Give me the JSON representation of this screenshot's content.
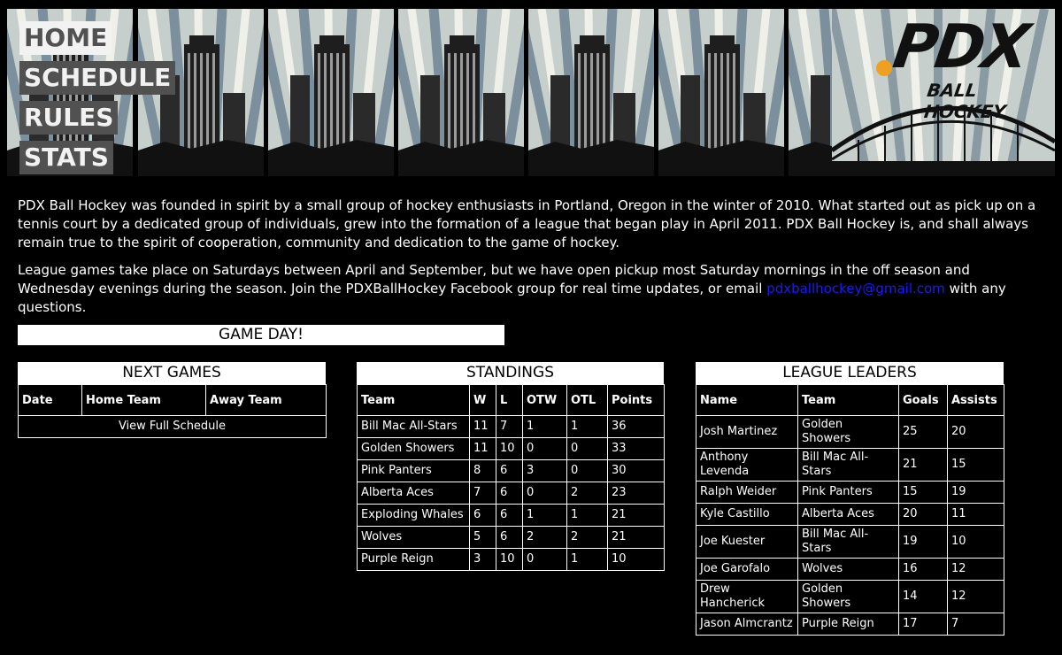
{
  "nav": {
    "home": "HOME",
    "schedule": "SCHEDULE",
    "rules": "RULES",
    "stats": "STATS"
  },
  "logo": {
    "main": "PDX",
    "sub": "BALL HOCKEY",
    "accent_color": "#f0a020"
  },
  "intro": {
    "p1": "PDX Ball Hockey was founded in spirit by a small group of hockey enthusiasts in Portland, Oregon in the winter of 2010. What started out as pick up on a tennis court by a dedicated group of individuals, grew into the formation of a league that began play in April 2011. PDX Ball Hockey is, and shall always remain true to the spirit of cooperation, community and dedication to the game of hockey.",
    "p2_before": "League games take place on Saturdays between April and September, but we have open pickup most Saturday mornings in the off season and Wednesday evenings during the season. Join the PDXBallHockey Facebook group for real time updates, or email ",
    "p2_link": "pdxballhockey@gmail.com",
    "p2_after": " with any questions."
  },
  "gameday": "GAME DAY!",
  "next_games": {
    "title": "NEXT GAMES",
    "headers": [
      "Date",
      "Home Team",
      "Away Team"
    ],
    "view_full": "View Full Schedule"
  },
  "standings": {
    "title": "STANDINGS",
    "headers": [
      "Team",
      "W",
      "L",
      "OTW",
      "OTL",
      "Points"
    ],
    "rows": [
      [
        "Bill Mac All-Stars",
        "11",
        "7",
        "1",
        "1",
        "36"
      ],
      [
        "Golden Showers",
        "11",
        "10",
        "0",
        "0",
        "33"
      ],
      [
        "Pink Panters",
        "8",
        "6",
        "3",
        "0",
        "30"
      ],
      [
        "Alberta Aces",
        "7",
        "6",
        "0",
        "2",
        "23"
      ],
      [
        "Exploding Whales",
        "6",
        "6",
        "1",
        "1",
        "21"
      ],
      [
        "Wolves",
        "5",
        "6",
        "2",
        "2",
        "21"
      ],
      [
        "Purple Reign",
        "3",
        "10",
        "0",
        "1",
        "10"
      ]
    ]
  },
  "leaders": {
    "title": "LEAGUE LEADERS",
    "headers": [
      "Name",
      "Team",
      "Goals",
      "Assists"
    ],
    "rows": [
      [
        "Josh Martinez",
        "Golden Showers",
        "25",
        "20"
      ],
      [
        "Anthony Levenda",
        "Bill Mac All-Stars",
        "21",
        "15"
      ],
      [
        "Ralph Weider",
        "Pink Panters",
        "15",
        "19"
      ],
      [
        "Kyle Castillo",
        "Alberta Aces",
        "20",
        "11"
      ],
      [
        "Joe Kuester",
        "Bill Mac All-Stars",
        "19",
        "10"
      ],
      [
        "Joe Garofalo",
        "Wolves",
        "16",
        "12"
      ],
      [
        "Drew Hancherick",
        "Golden Showers",
        "14",
        "12"
      ],
      [
        "Jason Almcrantz",
        "Purple Reign",
        "17",
        "7"
      ]
    ]
  }
}
